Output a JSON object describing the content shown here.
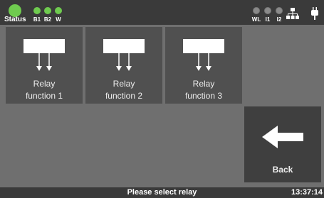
{
  "status": {
    "label": "Status",
    "color": "#6fcb4f",
    "indicators_left": [
      {
        "label": "B1",
        "state": "on"
      },
      {
        "label": "B2",
        "state": "on"
      },
      {
        "label": "W",
        "state": "on"
      }
    ],
    "indicators_right": [
      {
        "label": "WL",
        "state": "off"
      },
      {
        "label": "I1",
        "state": "off"
      },
      {
        "label": "I2",
        "state": "off"
      }
    ],
    "icons": [
      "network-icon",
      "plug-icon"
    ]
  },
  "relays": [
    {
      "line1": "Relay",
      "line2": "function 1"
    },
    {
      "line1": "Relay",
      "line2": "function 2"
    },
    {
      "line1": "Relay",
      "line2": "function 3"
    }
  ],
  "back": {
    "label": "Back",
    "icon": "arrow-left-icon"
  },
  "footer": {
    "message": "Please select relay",
    "time": "13:37:14"
  }
}
